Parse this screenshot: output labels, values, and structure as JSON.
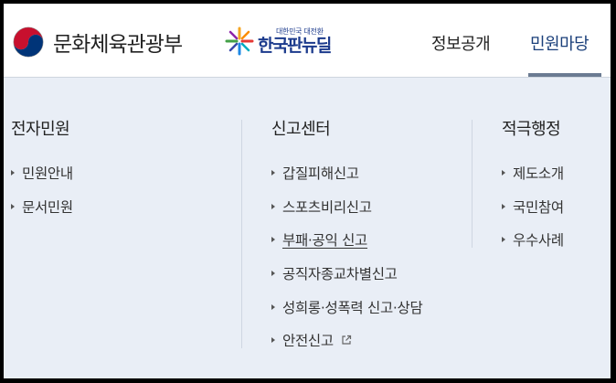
{
  "header": {
    "ministry_logo_text": "문화체육관광부",
    "campaign_logo_small": "대한민국 대전환",
    "campaign_logo_big": "한국판뉴딜",
    "nav": [
      {
        "label": "정보공개",
        "active": false
      },
      {
        "label": "민원마당",
        "active": true
      }
    ]
  },
  "panel": {
    "columns": [
      {
        "title": "전자민원",
        "items": [
          {
            "label": "민원안내"
          },
          {
            "label": "문서민원"
          }
        ]
      },
      {
        "title": "신고센터",
        "items": [
          {
            "label": "갑질피해신고"
          },
          {
            "label": "스포츠비리신고"
          },
          {
            "label": "부패·공익 신고",
            "hovered": true
          },
          {
            "label": "공직자종교차별신고"
          },
          {
            "label": "성희롱·성폭력 신고·상담"
          },
          {
            "label": "안전신고",
            "icon": "external-link-icon"
          }
        ]
      },
      {
        "title": "적극행정",
        "items": [
          {
            "label": "제도소개"
          },
          {
            "label": "국민참여"
          },
          {
            "label": "우수사례"
          }
        ]
      }
    ]
  },
  "colors": {
    "panel_bg": "#e9eef6",
    "active_nav": "#1a3f7a",
    "nav_indicator": "#6b7b92"
  }
}
